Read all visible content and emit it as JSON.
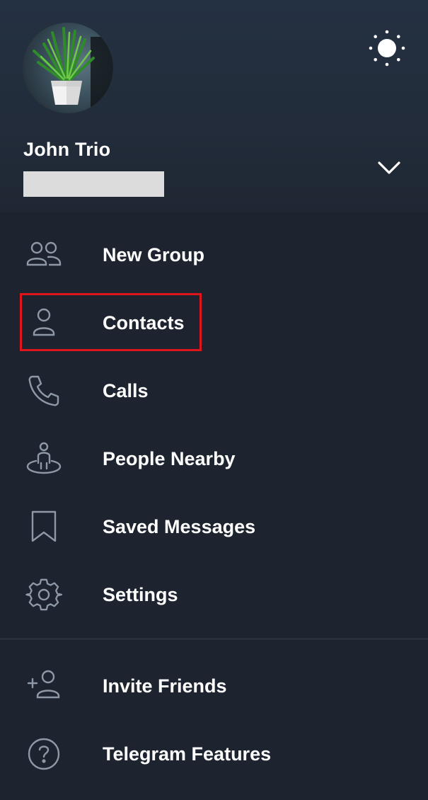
{
  "profile": {
    "name": "John Trio",
    "phone": ""
  },
  "menu": {
    "primary": [
      {
        "label": "New Group",
        "icon": "group-icon"
      },
      {
        "label": "Contacts",
        "icon": "person-icon"
      },
      {
        "label": "Calls",
        "icon": "phone-icon"
      },
      {
        "label": "People Nearby",
        "icon": "people-nearby-icon"
      },
      {
        "label": "Saved Messages",
        "icon": "bookmark-icon"
      },
      {
        "label": "Settings",
        "icon": "gear-icon"
      }
    ],
    "secondary": [
      {
        "label": "Invite Friends",
        "icon": "add-person-icon"
      },
      {
        "label": "Telegram Features",
        "icon": "question-icon"
      }
    ]
  },
  "colors": {
    "background": "#1d2430",
    "text": "#ffffff",
    "icon": "#8e98a6",
    "highlight": "#e0141b"
  }
}
